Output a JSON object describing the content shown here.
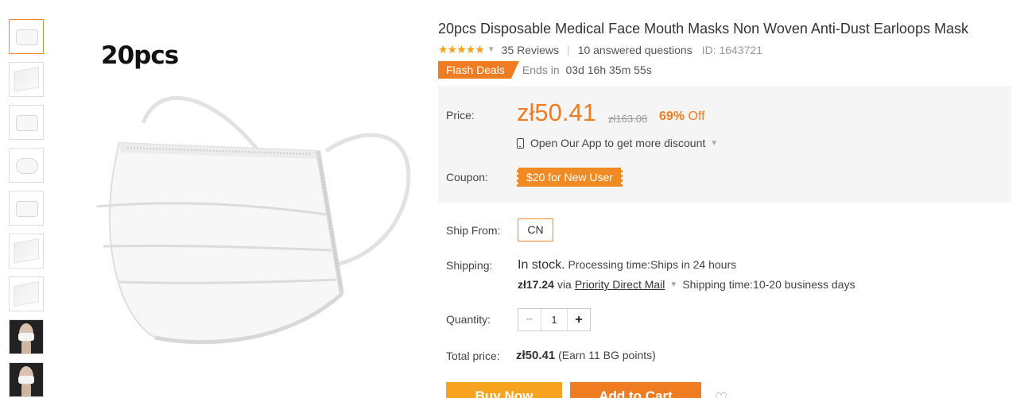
{
  "gallery": {
    "thumbnail_count": 9,
    "main_label": "20pcs"
  },
  "product": {
    "title": "20pcs Disposable Medical Face Mouth Masks Non Woven Anti-Dust Earloops Mask",
    "rating": 4.5,
    "stars": "★★★★★",
    "reviews": "35 Reviews",
    "questions": "10 answered questions",
    "id": "ID: 1643721"
  },
  "flash": {
    "tag": "Flash Deals",
    "ends_label": "Ends in",
    "ends_value": "03d 16h 35m 55s"
  },
  "pricing": {
    "price_label": "Price:",
    "price": "zł50.41",
    "old_price": "zł163.08",
    "discount_pct": "69%",
    "discount_word": "Off",
    "app_text": "Open Our App to get more discount",
    "coupon_label": "Coupon:",
    "coupon": "$20 for New User"
  },
  "shipping": {
    "ship_from_label": "Ship From:",
    "ship_from_value": "CN",
    "shipping_label": "Shipping:",
    "in_stock": "In stock.",
    "processing": "Processing time:Ships in 24 hours",
    "cost": "zł17.24",
    "via": "via",
    "method": "Priority Direct Mail",
    "time": "Shipping time:10-20 business days"
  },
  "quantity": {
    "label": "Quantity:",
    "minus": "−",
    "value": "1",
    "plus": "+"
  },
  "total": {
    "label": "Total price:",
    "value": "zł50.41",
    "points": "(Earn 11 BG points)"
  },
  "actions": {
    "buy": "Buy Now",
    "cart": "Add to Cart",
    "wish_icon": "heart-icon"
  },
  "colors": {
    "accent": "#f07c22",
    "buy": "#f8a31f",
    "price_bg": "#f5f5f5"
  }
}
